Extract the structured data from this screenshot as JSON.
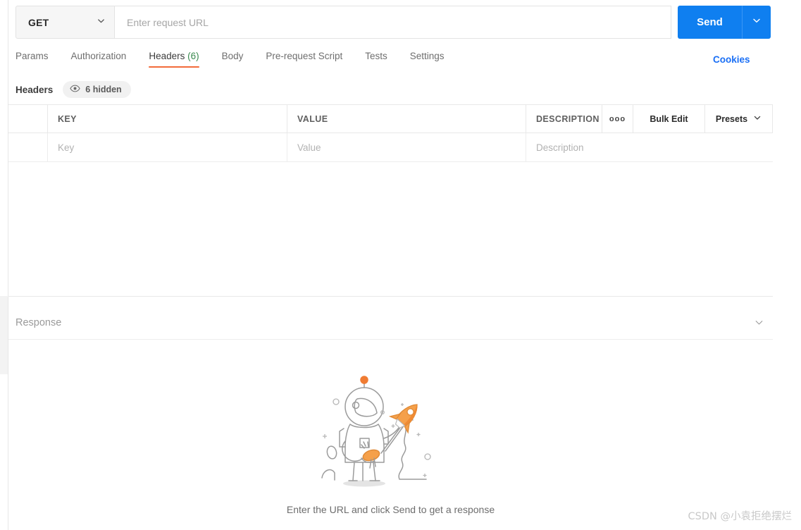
{
  "request_bar": {
    "method": "GET",
    "method_caret_icon": "chevron-down-icon",
    "url_placeholder": "Enter request URL",
    "url_value": "",
    "send_label": "Send",
    "send_caret_icon": "chevron-down-icon",
    "bulb_icon": "lightbulb-icon"
  },
  "tabs": [
    {
      "label": "Params",
      "active": false
    },
    {
      "label": "Authorization",
      "active": false
    },
    {
      "label": "Headers",
      "count": "(6)",
      "active": true
    },
    {
      "label": "Body",
      "active": false
    },
    {
      "label": "Pre-request Script",
      "active": false
    },
    {
      "label": "Tests",
      "active": false
    },
    {
      "label": "Settings",
      "active": false
    }
  ],
  "cookies_link": "Cookies",
  "headers_section": {
    "title": "Headers",
    "hidden_badge": {
      "icon": "eye-icon",
      "label": "6 hidden"
    }
  },
  "table": {
    "columns": [
      "",
      "KEY",
      "VALUE",
      "DESCRIPTION"
    ],
    "actions": {
      "more_icon": "ellipsis-icon",
      "more_glyph": "ooo",
      "bulk_edit": "Bulk Edit",
      "presets": "Presets",
      "presets_caret_icon": "chevron-down-icon"
    },
    "rows": [
      {
        "key": "Key",
        "value": "Value",
        "description": "Description"
      }
    ]
  },
  "response": {
    "title": "Response",
    "collapse_icon": "chevron-down-icon",
    "empty_state": {
      "illustration": "astronaut-rocket-illustration",
      "caption": "Enter the URL and click Send to get a response"
    }
  },
  "watermark": "CSDN @小袁拒绝摆烂",
  "colors": {
    "accent_blue": "#0f7ff0",
    "tab_underline_orange": "#f26b3a",
    "count_green": "#3a8a4f",
    "link_blue": "#1a6ff5",
    "illustration_orange": "#f5a04a",
    "illustration_line": "#9b9b9b"
  }
}
